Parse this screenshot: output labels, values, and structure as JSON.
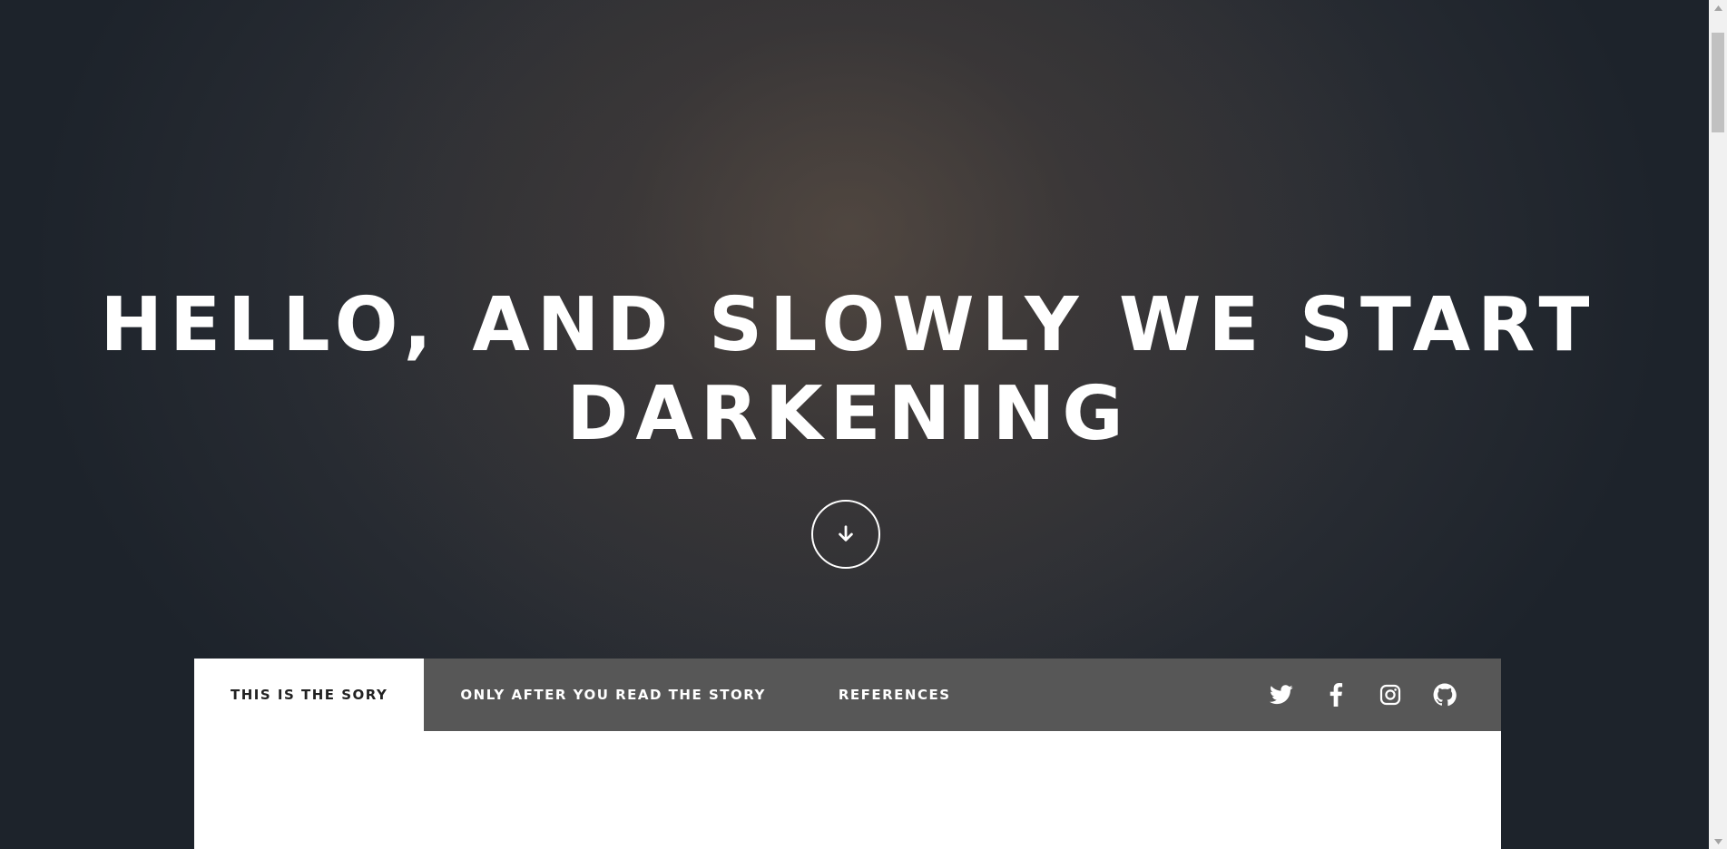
{
  "hero": {
    "title": "Hello, and slowly we start darkening",
    "scroll_down_icon": "arrow-down-icon"
  },
  "tabs": [
    {
      "label": "This is the sory",
      "active": true
    },
    {
      "label": "Only after you read the story",
      "active": false
    },
    {
      "label": "References",
      "active": false
    }
  ],
  "social": [
    {
      "icon": "twitter-icon"
    },
    {
      "icon": "facebook-icon"
    },
    {
      "icon": "instagram-icon"
    },
    {
      "icon": "github-icon"
    }
  ],
  "colors": {
    "tabbar_bg": "#575757",
    "active_tab_bg": "#ffffff",
    "text_light": "#ffffff",
    "text_dark": "#222222"
  }
}
